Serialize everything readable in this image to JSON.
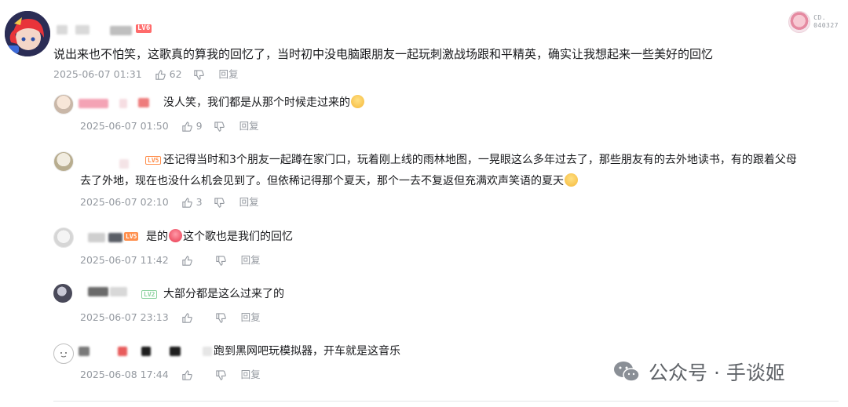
{
  "colors": {
    "text": "#18191c",
    "meta": "#9499a0",
    "lv6": "#ff6b6b",
    "lv5": "#ff8f4d",
    "lv2": "#8bd29e"
  },
  "top_badge": {
    "text_line1": "CD.",
    "text_line2": "040327"
  },
  "main_comment": {
    "level": "LV6",
    "content": "说出来也不怕笑，这歌真的算我的回忆了，当时初中没电脑跟朋友一起玩刺激战场跟和平精英，确实让我想起来一些美好的回忆",
    "date": "2025-06-07 01:31",
    "likes": "62",
    "reply_label": "回复"
  },
  "replies": [
    {
      "level": "",
      "content": "没人笑，我们都是从那个时候走过来的",
      "date": "2025-06-07 01:50",
      "likes": "9",
      "reply_label": "回复"
    },
    {
      "level": "LV5",
      "content_line1": "还记得当时和3个朋友一起蹲在家门口，玩着刚上线的雨林地图，一晃眼这么多年过去了，那些朋友有的去外地读书，有的跟着父母",
      "content_line2": "去了外地，现在也没什么机会见到了。但依稀记得那个夏天，那个一去不复返但充满欢声笑语的夏天",
      "date": "2025-06-07 02:10",
      "likes": "3",
      "reply_label": "回复"
    },
    {
      "level": "LV5",
      "content_pre": "是的",
      "content_post": "这个歌也是我们的回忆",
      "date": "2025-06-07 11:42",
      "likes": "",
      "reply_label": "回复"
    },
    {
      "level": "LV2",
      "content": "大部分都是这么过来了的",
      "date": "2025-06-07 23:13",
      "likes": "",
      "reply_label": "回复"
    },
    {
      "level": "",
      "content": "跑到黑网吧玩模拟器，开车就是这音乐",
      "date": "2025-06-08 17:44",
      "likes": "",
      "reply_label": "回复"
    }
  ],
  "watermark": {
    "text": "公众号 · 手谈姬"
  }
}
